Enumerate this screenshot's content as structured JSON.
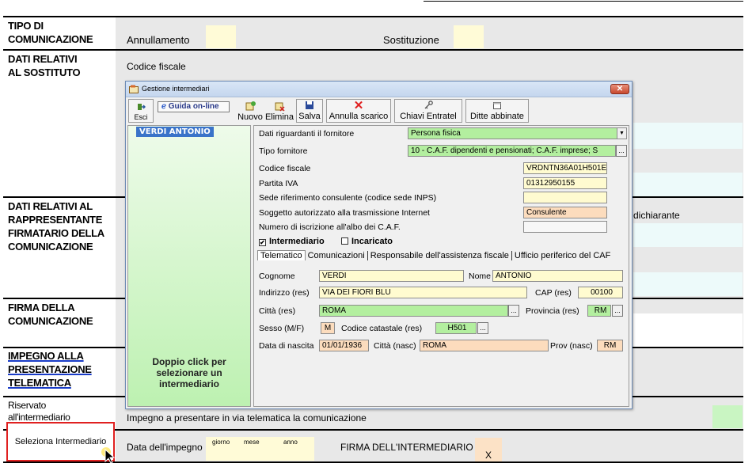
{
  "form": {
    "sections": {
      "tipo": [
        "TIPO DI",
        "COMUNICAZIONE"
      ],
      "sostituto": [
        "DATI RELATIVI",
        "AL SOSTITUTO"
      ],
      "rappresentante": [
        "DATI RELATIVI AL",
        "RAPPRESENTANTE",
        "FIRMATARIO DELLA",
        "COMUNICAZIONE"
      ],
      "firma": [
        "FIRMA DELLA",
        "COMUNICAZIONE"
      ],
      "impegno": [
        "IMPEGNO ALLA",
        "PRESENTAZIONE",
        "TELEMATICA"
      ],
      "riservato": [
        "Riservato",
        "all'intermediario"
      ]
    },
    "annullamento": "Annullamento",
    "sostituzione": "Sostituzione",
    "codice_fiscale": "Codice fiscale",
    "dichiarante": "dichiarante",
    "impegno_text": "Impegno a presentare in via telematica la comunicazione",
    "data_impegno": "Data dell'impegno",
    "giorno": "giorno",
    "mese": "mese",
    "anno": "anno",
    "firma_intermediario": "FIRMA DELL'INTERMEDIARIO",
    "firma_mark": "X",
    "seleziona_button": "Seleziona Intermediario"
  },
  "dialog": {
    "title": "Gestione intermediari",
    "toolbar": {
      "esci": "Esci",
      "guida": "Guida on-line",
      "nuovo": "Nuovo",
      "elimina": "Elimina",
      "salva": "Salva",
      "annulla": "Annulla scarico",
      "chiavi": "Chiavi Entratel",
      "ditte": "Ditte abbinate"
    },
    "list": {
      "selected": "VERDI ANTONIO",
      "hint": "Doppio click per selezionare un intermediario"
    },
    "fields": {
      "fornitore_label": "Dati riguardanti il fornitore",
      "fornitore_value": "Persona fisica",
      "tipo_label": "Tipo fornitore",
      "tipo_value": "10 - C.A.F. dipendenti e pensionati; C.A.F. imprese; S",
      "cf_label": "Codice fiscale",
      "cf_value": "VRDNTN36A01H501E",
      "piva_label": "Partita IVA",
      "piva_value": "01312950155",
      "sede_label": "Sede riferimento consulente (codice sede INPS)",
      "sede_value": "",
      "soggetto_label": "Soggetto autorizzato alla trasmissione Internet",
      "soggetto_value": "Consulente",
      "albo_label": "Numero di iscrizione all'albo dei C.A.F.",
      "albo_value": ""
    },
    "checks": {
      "intermediario": "Intermediario",
      "incaricato": "Incaricato"
    },
    "tabs": [
      "Telematico",
      "Comunicazioni",
      "Responsabile dell'assistenza fiscale",
      "Ufficio periferico del CAF"
    ],
    "telematico": {
      "cognome_label": "Cognome",
      "cognome_value": "VERDI",
      "nome_label": "Nome",
      "nome_value": "ANTONIO",
      "indirizzo_label": "Indirizzo (res)",
      "indirizzo_value": "VIA DEI FIORI BLU",
      "cap_label": "CAP (res)",
      "cap_value": "00100",
      "citta_label": "Città (res)",
      "citta_value": "ROMA",
      "provincia_label": "Provincia (res)",
      "provincia_value": "RM",
      "sesso_label": "Sesso (M/F)",
      "sesso_value": "M",
      "catastale_label": "Codice catastale (res)",
      "catastale_value": "H501",
      "nascita_label": "Data di nascita",
      "nascita_value": "01/01/1936",
      "citta_nasc_label": "Città (nasc)",
      "citta_nasc_value": "ROMA",
      "prov_nasc_label": "Prov (nasc)",
      "prov_nasc_value": "RM"
    }
  },
  "icons": {
    "close": "✕",
    "dots": "...",
    "dropdown": "▼",
    "check": "✔"
  }
}
